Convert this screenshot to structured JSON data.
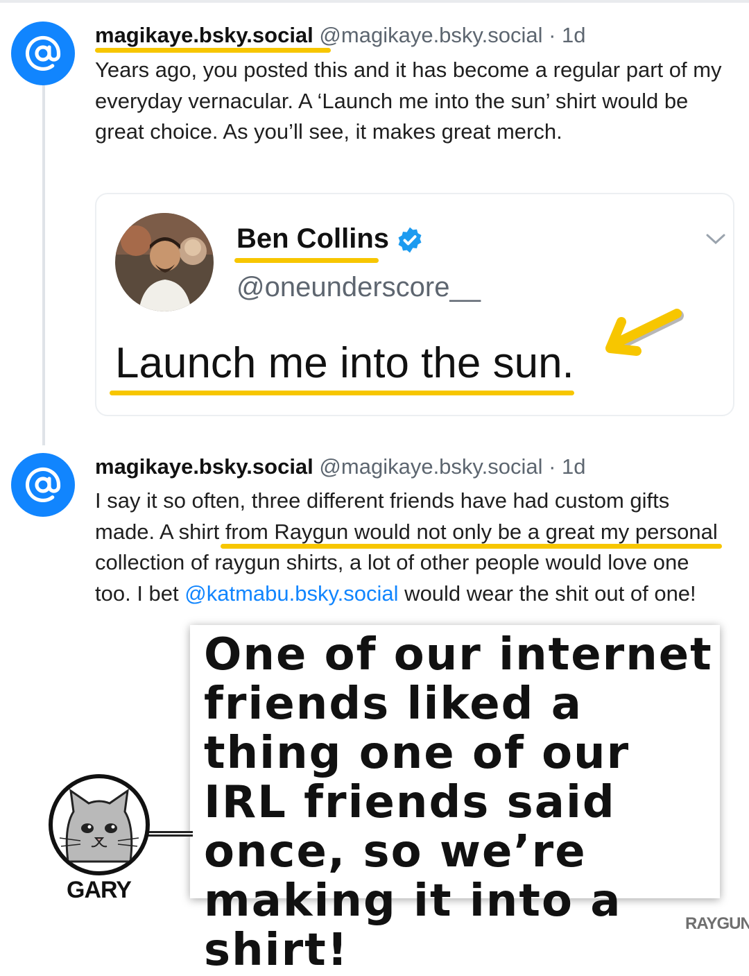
{
  "post1": {
    "display_name": "magikaye.bsky.social",
    "handle": "@magikaye.bsky.social",
    "time": "· 1d",
    "text": "Years ago, you posted this and it has become a regular part of my everyday vernacular. A ‘Launch me into the sun’ shirt would be great choice. As you’ll see, it makes great merch."
  },
  "embed": {
    "name": "Ben Collins",
    "handle": "@oneunderscore__",
    "text": "Launch me into the sun."
  },
  "post2": {
    "display_name": "magikaye.bsky.social",
    "handle": "@magikaye.bsky.social",
    "time": "· 1d",
    "text_a": "I say it so often, three different friends have had custom gifts made. A shirt from Raygun would not only be a great my personal collection of raygun shirts, a lot of other people would love one too. I bet ",
    "mention": "@katmabu.bsky.social",
    "text_b": " would wear the shit out of one!"
  },
  "callout": {
    "text": "One of our internet friends liked a thing one of our IRL friends said once, so we’re making it into a shirt!"
  },
  "mascot": {
    "label": "GARY"
  },
  "brand": "RAYGUN",
  "colors": {
    "accent": "#1185fe",
    "highlight": "#f7c600"
  },
  "icons": [
    "at-sign-icon",
    "verified-badge-icon",
    "chevron-down-icon",
    "arrow-icon",
    "cat-icon"
  ]
}
